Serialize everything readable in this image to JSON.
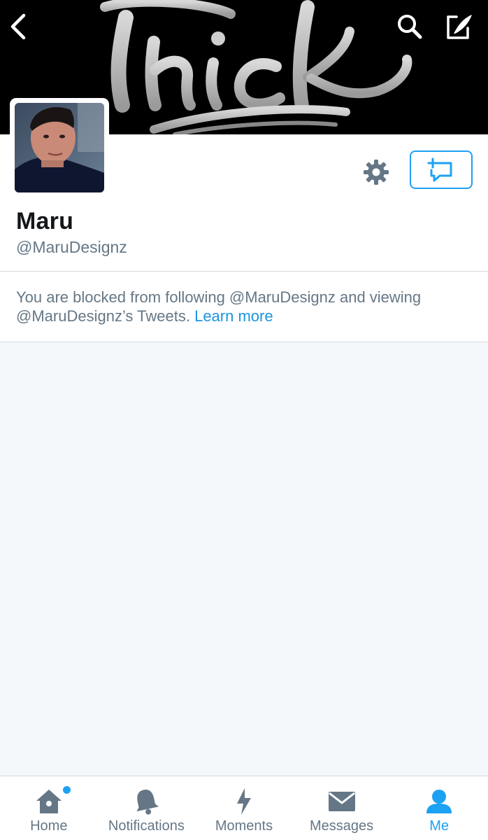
{
  "header": {
    "banner_text": "thick",
    "back_icon": "chevron-left-icon",
    "search_icon": "search-icon",
    "compose_icon": "compose-tweet-icon"
  },
  "profile": {
    "display_name": "Maru",
    "handle": "@MaruDesignz",
    "settings_icon": "gear-icon",
    "dm_icon": "new-message-icon"
  },
  "notice": {
    "text": "You are blocked from following @MaruDesignz and viewing @MaruDesignz’s Tweets.",
    "link": "Learn more"
  },
  "tabs": [
    {
      "label": "Home",
      "icon": "home-icon",
      "badge": true
    },
    {
      "label": "Notifications",
      "icon": "bell-icon"
    },
    {
      "label": "Moments",
      "icon": "lightning-icon"
    },
    {
      "label": "Messages",
      "icon": "envelope-icon"
    },
    {
      "label": "Me",
      "icon": "person-icon",
      "active": true
    }
  ],
  "colors": {
    "accent": "#1da1f2",
    "icon_gray": "#657786",
    "background": "#f5f8fa"
  }
}
